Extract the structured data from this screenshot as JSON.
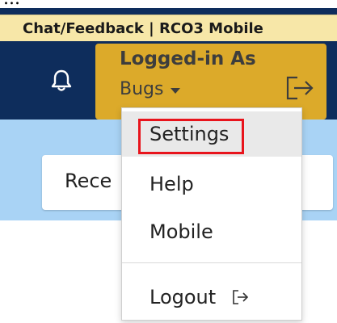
{
  "top_fragment": "...",
  "feedback_bar": {
    "label": "Chat/Feedback | RCO3 Mobile"
  },
  "header": {
    "account_title": "Logged-in As",
    "username": "Bugs"
  },
  "page": {
    "recent_label": "Rece"
  },
  "account_menu": {
    "items": [
      {
        "label": "Settings",
        "highlighted": true
      },
      {
        "label": "Help"
      },
      {
        "label": "Mobile"
      },
      {
        "label": "Logout"
      }
    ]
  },
  "icons": {
    "bell": "bell-icon",
    "logout": "logout-icon",
    "caret": "caret-down-icon"
  },
  "colors": {
    "navbar": "#0e2d5c",
    "feedback_bar": "#f7e7a8",
    "account_panel": "#dcaa2a",
    "subbar": "#a9d3f5",
    "highlight_box": "#e8141c"
  }
}
